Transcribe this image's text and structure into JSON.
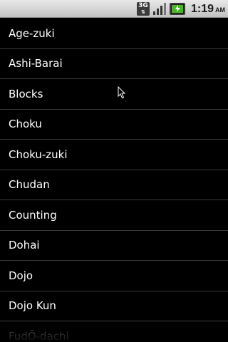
{
  "status_bar": {
    "network_label": "3G",
    "time": "1:19",
    "ampm": "AM",
    "icons": [
      "network-3g-icon",
      "signal-icon",
      "battery-icon"
    ]
  },
  "list": {
    "items": [
      {
        "label": "Age-zuki"
      },
      {
        "label": "Ashi-Barai"
      },
      {
        "label": "Blocks"
      },
      {
        "label": "Choku"
      },
      {
        "label": "Choku-zuki"
      },
      {
        "label": "Chudan"
      },
      {
        "label": "Counting"
      },
      {
        "label": "Dohai"
      },
      {
        "label": "Dojo"
      },
      {
        "label": "Dojo Kun"
      },
      {
        "label": "FudŌ-dachi"
      }
    ]
  },
  "colors": {
    "background": "#000000",
    "text": "#ffffff",
    "divider": "#3a3a3a",
    "battery": "#4db32a"
  }
}
